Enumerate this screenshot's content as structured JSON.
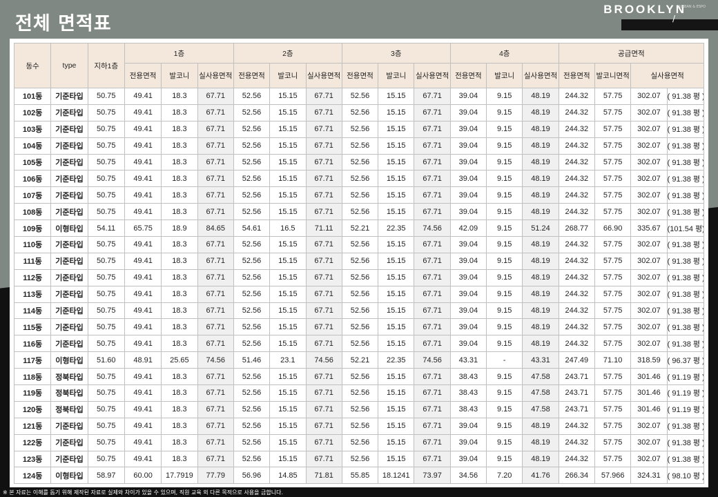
{
  "title": "전체 면적표",
  "brand": {
    "name": "BROOKLYN",
    "sub": "URBAN & ESPO",
    "mark": "/"
  },
  "footnote": "※ 본 자료는 이해를 돕기 위해 제작된 자료로 실제와 차이가 있을 수 있으며, 직원 교육 외 다른 목적으로 사용을 금합니다.",
  "header": {
    "dongsu": "동수",
    "type": "type",
    "basement": "지하1층",
    "floors": [
      "1층",
      "2층",
      "3층",
      "4층"
    ],
    "supply": "공급면적",
    "sub_floor": [
      "전용면적",
      "발코니",
      "실사용면적"
    ],
    "sub_supply": [
      "전용면적",
      "발코니면적",
      "실사용면적"
    ]
  },
  "rows": [
    [
      "101동",
      "기준타입",
      "50.75",
      "49.41",
      "18.3",
      "67.71",
      "52.56",
      "15.15",
      "67.71",
      "52.56",
      "15.15",
      "67.71",
      "39.04",
      "9.15",
      "48.19",
      "244.32",
      "57.75",
      "302.07",
      "( 91.38 평 )"
    ],
    [
      "102동",
      "기준타입",
      "50.75",
      "49.41",
      "18.3",
      "67.71",
      "52.56",
      "15.15",
      "67.71",
      "52.56",
      "15.15",
      "67.71",
      "39.04",
      "9.15",
      "48.19",
      "244.32",
      "57.75",
      "302.07",
      "( 91.38 평 )"
    ],
    [
      "103동",
      "기준타입",
      "50.75",
      "49.41",
      "18.3",
      "67.71",
      "52.56",
      "15.15",
      "67.71",
      "52.56",
      "15.15",
      "67.71",
      "39.04",
      "9.15",
      "48.19",
      "244.32",
      "57.75",
      "302.07",
      "( 91.38 평 )"
    ],
    [
      "104동",
      "기준타입",
      "50.75",
      "49.41",
      "18.3",
      "67.71",
      "52.56",
      "15.15",
      "67.71",
      "52.56",
      "15.15",
      "67.71",
      "39.04",
      "9.15",
      "48.19",
      "244.32",
      "57.75",
      "302.07",
      "( 91.38 평 )"
    ],
    [
      "105동",
      "기준타입",
      "50.75",
      "49.41",
      "18.3",
      "67.71",
      "52.56",
      "15.15",
      "67.71",
      "52.56",
      "15.15",
      "67.71",
      "39.04",
      "9.15",
      "48.19",
      "244.32",
      "57.75",
      "302.07",
      "( 91.38 평 )"
    ],
    [
      "106동",
      "기준타입",
      "50.75",
      "49.41",
      "18.3",
      "67.71",
      "52.56",
      "15.15",
      "67.71",
      "52.56",
      "15.15",
      "67.71",
      "39.04",
      "9.15",
      "48.19",
      "244.32",
      "57.75",
      "302.07",
      "( 91.38 평 )"
    ],
    [
      "107동",
      "기준타입",
      "50.75",
      "49.41",
      "18.3",
      "67.71",
      "52.56",
      "15.15",
      "67.71",
      "52.56",
      "15.15",
      "67.71",
      "39.04",
      "9.15",
      "48.19",
      "244.32",
      "57.75",
      "302.07",
      "( 91.38 평 )"
    ],
    [
      "108동",
      "기준타입",
      "50.75",
      "49.41",
      "18.3",
      "67.71",
      "52.56",
      "15.15",
      "67.71",
      "52.56",
      "15.15",
      "67.71",
      "39.04",
      "9.15",
      "48.19",
      "244.32",
      "57.75",
      "302.07",
      "( 91.38 평 )"
    ],
    [
      "109동",
      "이형타입",
      "54.11",
      "65.75",
      "18.9",
      "84.65",
      "54.61",
      "16.5",
      "71.11",
      "52.21",
      "22.35",
      "74.56",
      "42.09",
      "9.15",
      "51.24",
      "268.77",
      "66.90",
      "335.67",
      "(101.54 평)"
    ],
    [
      "110동",
      "기준타입",
      "50.75",
      "49.41",
      "18.3",
      "67.71",
      "52.56",
      "15.15",
      "67.71",
      "52.56",
      "15.15",
      "67.71",
      "39.04",
      "9.15",
      "48.19",
      "244.32",
      "57.75",
      "302.07",
      "( 91.38 평 )"
    ],
    [
      "111동",
      "기준타입",
      "50.75",
      "49.41",
      "18.3",
      "67.71",
      "52.56",
      "15.15",
      "67.71",
      "52.56",
      "15.15",
      "67.71",
      "39.04",
      "9.15",
      "48.19",
      "244.32",
      "57.75",
      "302.07",
      "( 91.38 평 )"
    ],
    [
      "112동",
      "기준타입",
      "50.75",
      "49.41",
      "18.3",
      "67.71",
      "52.56",
      "15.15",
      "67.71",
      "52.56",
      "15.15",
      "67.71",
      "39.04",
      "9.15",
      "48.19",
      "244.32",
      "57.75",
      "302.07",
      "( 91.38 평 )"
    ],
    [
      "113동",
      "기준타입",
      "50.75",
      "49.41",
      "18.3",
      "67.71",
      "52.56",
      "15.15",
      "67.71",
      "52.56",
      "15.15",
      "67.71",
      "39.04",
      "9.15",
      "48.19",
      "244.32",
      "57.75",
      "302.07",
      "( 91.38 평 )"
    ],
    [
      "114동",
      "기준타입",
      "50.75",
      "49.41",
      "18.3",
      "67.71",
      "52.56",
      "15.15",
      "67.71",
      "52.56",
      "15.15",
      "67.71",
      "39.04",
      "9.15",
      "48.19",
      "244.32",
      "57.75",
      "302.07",
      "( 91.38 평 )"
    ],
    [
      "115동",
      "기준타입",
      "50.75",
      "49.41",
      "18.3",
      "67.71",
      "52.56",
      "15.15",
      "67.71",
      "52.56",
      "15.15",
      "67.71",
      "39.04",
      "9.15",
      "48.19",
      "244.32",
      "57.75",
      "302.07",
      "( 91.38 평 )"
    ],
    [
      "116동",
      "기준타입",
      "50.75",
      "49.41",
      "18.3",
      "67.71",
      "52.56",
      "15.15",
      "67.71",
      "52.56",
      "15.15",
      "67.71",
      "39.04",
      "9.15",
      "48.19",
      "244.32",
      "57.75",
      "302.07",
      "( 91.38 평 )"
    ],
    [
      "117동",
      "이형타입",
      "51.60",
      "48.91",
      "25.65",
      "74.56",
      "51.46",
      "23.1",
      "74.56",
      "52.21",
      "22.35",
      "74.56",
      "43.31",
      "-",
      "43.31",
      "247.49",
      "71.10",
      "318.59",
      "( 96.37 평 )"
    ],
    [
      "118동",
      "정북타입",
      "50.75",
      "49.41",
      "18.3",
      "67.71",
      "52.56",
      "15.15",
      "67.71",
      "52.56",
      "15.15",
      "67.71",
      "38.43",
      "9.15",
      "47.58",
      "243.71",
      "57.75",
      "301.46",
      "( 91.19 평 )"
    ],
    [
      "119동",
      "정북타입",
      "50.75",
      "49.41",
      "18.3",
      "67.71",
      "52.56",
      "15.15",
      "67.71",
      "52.56",
      "15.15",
      "67.71",
      "38.43",
      "9.15",
      "47.58",
      "243.71",
      "57.75",
      "301.46",
      "( 91.19 평 )"
    ],
    [
      "120동",
      "정북타입",
      "50.75",
      "49.41",
      "18.3",
      "67.71",
      "52.56",
      "15.15",
      "67.71",
      "52.56",
      "15.15",
      "67.71",
      "38.43",
      "9.15",
      "47.58",
      "243.71",
      "57.75",
      "301.46",
      "( 91.19 평 )"
    ],
    [
      "121동",
      "기준타입",
      "50.75",
      "49.41",
      "18.3",
      "67.71",
      "52.56",
      "15.15",
      "67.71",
      "52.56",
      "15.15",
      "67.71",
      "39.04",
      "9.15",
      "48.19",
      "244.32",
      "57.75",
      "302.07",
      "( 91.38 평 )"
    ],
    [
      "122동",
      "기준타입",
      "50.75",
      "49.41",
      "18.3",
      "67.71",
      "52.56",
      "15.15",
      "67.71",
      "52.56",
      "15.15",
      "67.71",
      "39.04",
      "9.15",
      "48.19",
      "244.32",
      "57.75",
      "302.07",
      "( 91.38 평 )"
    ],
    [
      "123동",
      "기준타입",
      "50.75",
      "49.41",
      "18.3",
      "67.71",
      "52.56",
      "15.15",
      "67.71",
      "52.56",
      "15.15",
      "67.71",
      "39.04",
      "9.15",
      "48.19",
      "244.32",
      "57.75",
      "302.07",
      "( 91.38 평 )"
    ],
    [
      "124동",
      "이형타입",
      "58.97",
      "60.00",
      "17.7919",
      "77.79",
      "56.96",
      "14.85",
      "71.81",
      "55.85",
      "18.1241",
      "73.97",
      "34.56",
      "7.20",
      "41.76",
      "266.34",
      "57.966",
      "324.31",
      "( 98.10 평 )"
    ]
  ]
}
